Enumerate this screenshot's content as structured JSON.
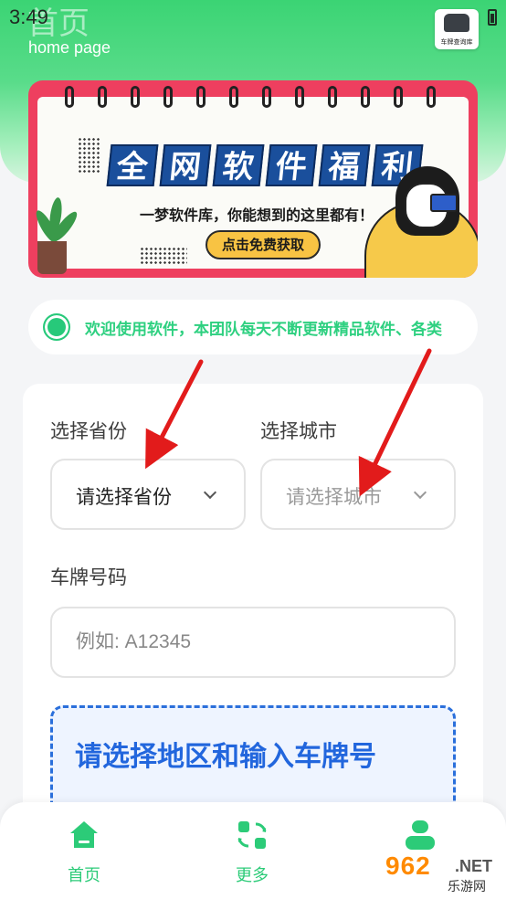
{
  "status_bar": {
    "time": "3:49"
  },
  "header": {
    "title": "首页",
    "subtitle": "home page",
    "app_badge_label": "车牌查询库"
  },
  "banner": {
    "title_chars": [
      "全",
      "网",
      "软",
      "件",
      "福",
      "利"
    ],
    "caption": "一梦软件库，你能想到的这里都有！",
    "cta_label": "点击免费获取"
  },
  "notice": {
    "text": "欢迎使用软件，本团队每天不断更新精品软件、各类"
  },
  "form": {
    "province_label": "选择省份",
    "province_value": "请选择省份",
    "city_label": "选择城市",
    "city_placeholder": "请选择城市",
    "plate_label": "车牌号码",
    "plate_placeholder": "例如: A12345",
    "hint": "请选择地区和输入车牌号"
  },
  "bottom_nav": {
    "items": [
      {
        "label": "首页",
        "icon": "home-icon",
        "active": true
      },
      {
        "label": "更多",
        "icon": "refresh-icon",
        "active": false
      },
      {
        "label": "",
        "icon": "user-icon",
        "active": false
      }
    ]
  },
  "watermark": {
    "num": "962",
    "net": ".NET",
    "cn": "乐游网"
  },
  "colors": {
    "accent": "#2ccb78",
    "header_gradient_top": "#3bd474",
    "banner_frame": "#ee3f5f",
    "hint_text": "#2266dd",
    "arrow": "#e21b1b"
  }
}
